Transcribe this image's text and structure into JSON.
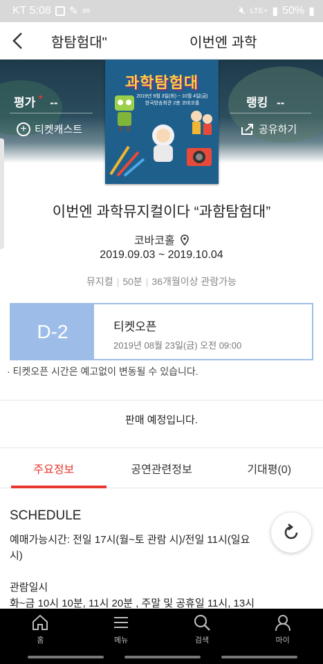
{
  "status_bar": {
    "carrier_time": "KT 5:08",
    "network": "LTE+",
    "battery": "50%"
  },
  "app_bar": {
    "back_icon": "chevron-left-icon",
    "marquee_text_1": "함탐험대\"",
    "marquee_text_2": "이번엔 과학"
  },
  "hero": {
    "rating_label": "평가",
    "rating_star": "*",
    "rating_value": "--",
    "ranking_label": "랭킹",
    "ranking_value": "--",
    "ticketcast_label": "티켓캐스트",
    "share_label": "공유하기"
  },
  "poster": {
    "title": "과학탐험대",
    "line_1": "2019년 9월 3일(화) ~ 10월 4일(금)",
    "line_2": "한국방송회관 2층 코바코홀"
  },
  "show": {
    "title": "이번엔 과학뮤지컬이다 “과함탐험대”",
    "venue": "코바코홀",
    "period": "2019.09.03 ~ 2019.10.04",
    "genre": "뮤지컬",
    "runtime": "50분",
    "age": "36개월이상 관람가능"
  },
  "ticket_open": {
    "dday": "D-2",
    "label": "티켓오픈",
    "datetime": "2019년 08월 23일(금) 오전 09:00",
    "notice": "·  티켓오픈 시간은 예고없이 변동될 수 있습니다."
  },
  "sale_status": "판매 예정입니다.",
  "tabs": [
    {
      "label": "주요정보",
      "active": true
    },
    {
      "label": "공연관련정보",
      "active": false
    },
    {
      "label": "기대평(0)",
      "active": false
    }
  ],
  "content": {
    "section_title": "SCHEDULE",
    "booking_time_line1": "예매가능시간: 전일 17시(월~토 관람 시)/전일 11시(일요",
    "booking_time_line2": "시)",
    "view_date_label": "관람일시",
    "view_date_line": "화~금 10시 10분, 11시 20분 , 주말 및 공휴일 11시, 13시"
  },
  "bottom_nav": [
    {
      "label": "홈",
      "icon": "home-icon"
    },
    {
      "label": "메뉴",
      "icon": "menu-icon"
    },
    {
      "label": "검색",
      "icon": "search-icon"
    },
    {
      "label": "마이",
      "icon": "user-icon"
    }
  ],
  "colors": {
    "accent": "#e8372c",
    "dday_blue": "#9dbde8"
  }
}
